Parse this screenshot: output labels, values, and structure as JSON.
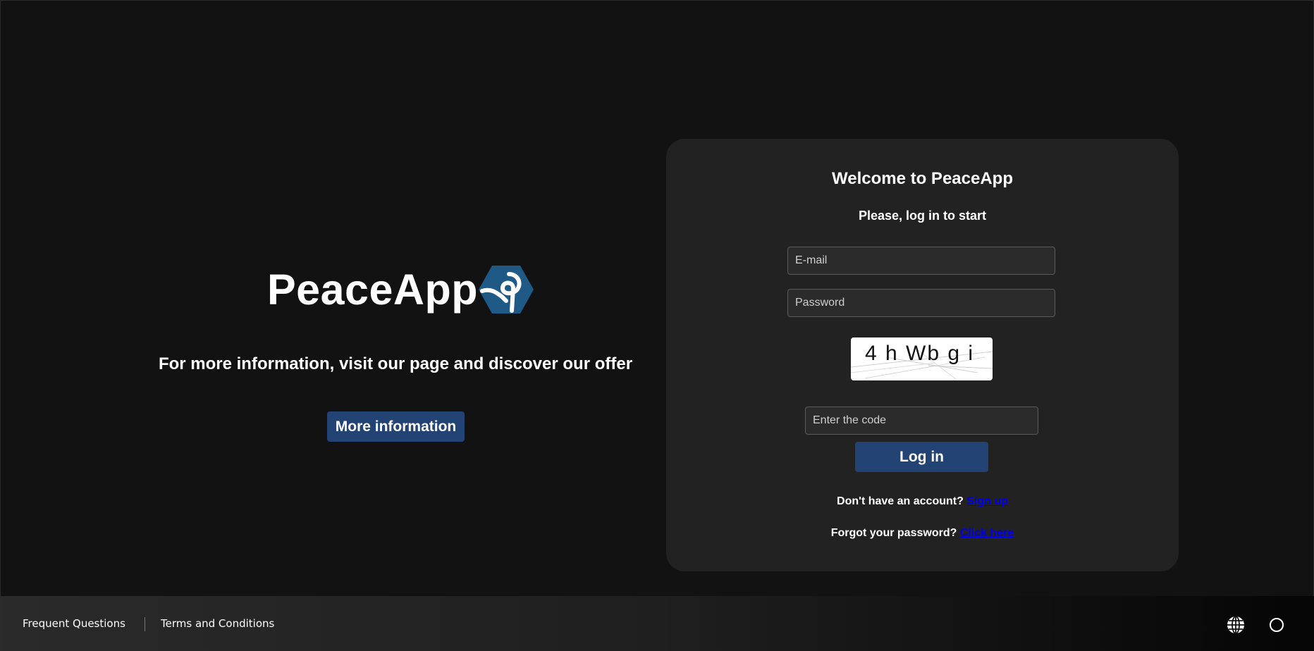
{
  "hero": {
    "logo_text": "PeaceApp",
    "tagline": "For more information, visit our page and discover our offer",
    "more_button": "More information",
    "logo_icon": "peaceapp-hexagon-logo",
    "accent_color": "#234375",
    "logo_color": "#1f5a86"
  },
  "login": {
    "title": "Welcome to PeaceApp",
    "subtitle": "Please, log in to start",
    "email_placeholder": "E-mail",
    "password_placeholder": "Password",
    "captcha_text": "4 h Wb g i",
    "code_placeholder": "Enter the code",
    "login_button": "Log in",
    "signup_prompt": "Don't have an account?",
    "signup_link": "Sign up",
    "forgot_prompt": "Forgot your password?",
    "forgot_link": "Click here"
  },
  "footer": {
    "faq": "Frequent Questions",
    "terms": "Terms and Conditions",
    "language_icon": "globe-icon",
    "theme_icon": "circle-icon"
  }
}
